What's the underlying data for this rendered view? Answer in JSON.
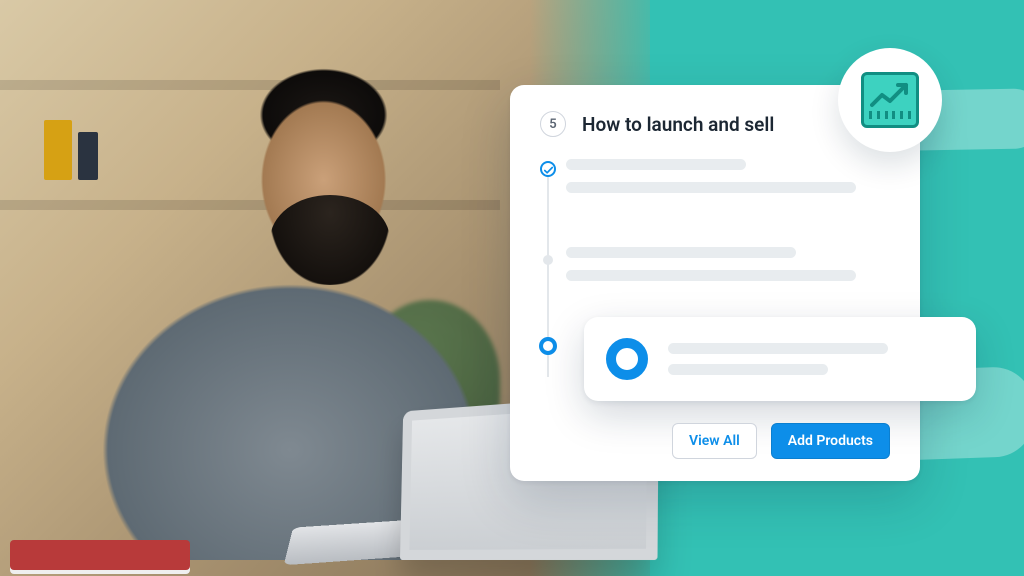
{
  "card": {
    "step_number": "5",
    "title": "How to launch and sell"
  },
  "buttons": {
    "view_all": "View All",
    "add_products": "Add Products"
  },
  "icons": {
    "analytics": "analytics-growth-icon",
    "check": "check-icon",
    "ring": "progress-ring-icon"
  },
  "colors": {
    "accent": "#0d8ee9",
    "teal": "#33c1b4",
    "placeholder": "#e8ecef"
  }
}
